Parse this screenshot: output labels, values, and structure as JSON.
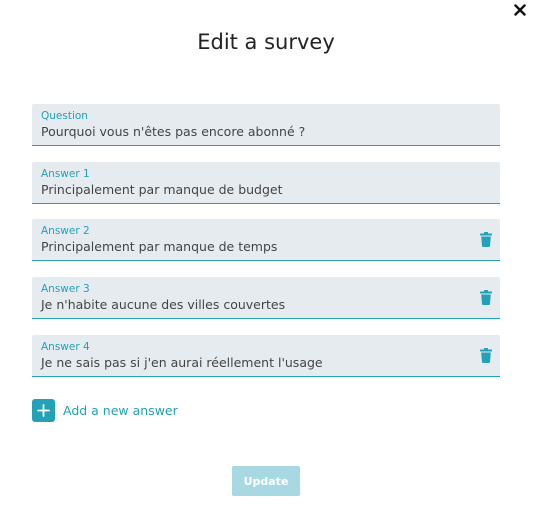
{
  "dialog": {
    "title": "Edit a survey",
    "close_icon": "close-icon"
  },
  "question": {
    "label": "Question",
    "value": "Pourquoi vous n'êtes pas encore abonné ?"
  },
  "answers": [
    {
      "label": "Answer 1",
      "value": "Principalement par manque de budget",
      "deletable": false
    },
    {
      "label": "Answer 2",
      "value": "Principalement par manque de temps",
      "deletable": true
    },
    {
      "label": "Answer 3",
      "value": "Je n'habite aucune des villes couvertes",
      "deletable": true
    },
    {
      "label": "Answer 4",
      "value": "Je ne sais pas si j'en aurai réellement l'usage",
      "deletable": true
    }
  ],
  "actions": {
    "add_answer_label": "Add a new answer",
    "update_label": "Update"
  },
  "colors": {
    "accent": "#23a1b6",
    "field_bg": "#e6ebf0",
    "update_disabled_bg": "#a8d8e2"
  }
}
